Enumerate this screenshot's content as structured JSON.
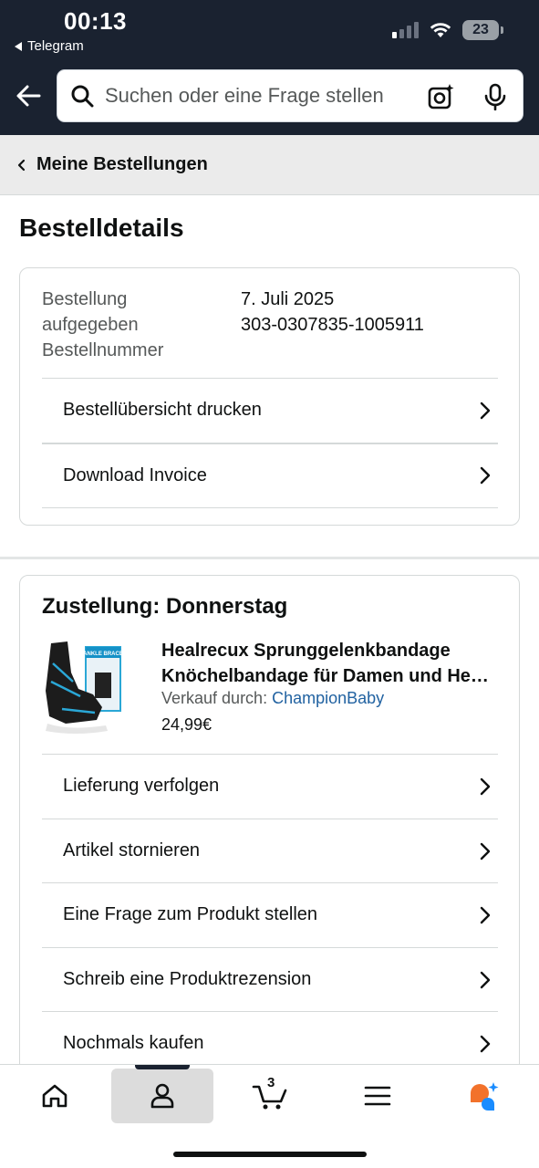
{
  "status_bar": {
    "time": "00:13",
    "back_app": "Telegram",
    "battery": "23"
  },
  "search": {
    "placeholder": "Suchen oder eine Frage stellen"
  },
  "breadcrumb": {
    "label": "Meine Bestellungen"
  },
  "page_title": "Bestelldetails",
  "order_info": {
    "labels": [
      "Bestellung",
      "aufgegeben",
      "Bestellnummer"
    ],
    "date": "7. Juli 2025",
    "number": "303-0307835-1005911"
  },
  "order_actions": [
    {
      "label": "Bestellübersicht drucken"
    },
    {
      "label": "Download Invoice"
    }
  ],
  "shipment": {
    "delivery": "Zustellung: Donnerstag",
    "product": {
      "name_line1": "Healrecux Sprunggelenkbandage",
      "name_line2": "Knöchelbandage für Damen und He…",
      "seller_label": "Verkauf durch:",
      "seller": "ChampionBaby",
      "price": "24,99€",
      "image_text": "ANKLE BRACE"
    },
    "actions": [
      {
        "label": "Lieferung verfolgen"
      },
      {
        "label": "Artikel stornieren"
      },
      {
        "label": "Eine Frage zum Produkt stellen"
      },
      {
        "label": "Schreib eine Produktrezension"
      },
      {
        "label": "Nochmals kaufen"
      }
    ]
  },
  "bottom_nav": {
    "cart_count": "3",
    "active": "account"
  },
  "colors": {
    "header_bg": "#1a2230",
    "link": "#2162a1",
    "assistant_orange": "#f2722b",
    "assistant_blue": "#1a8cff"
  }
}
